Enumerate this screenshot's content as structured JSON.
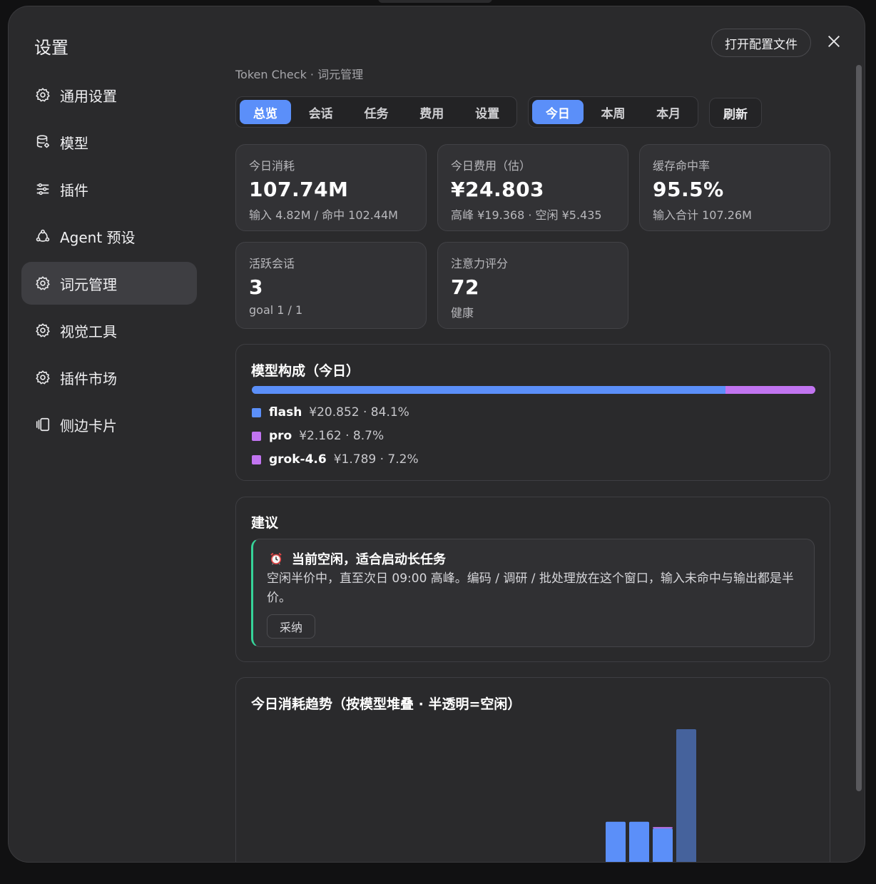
{
  "modal": {
    "title": "设置",
    "open_config_label": "打开配置文件",
    "close_icon": "close-icon"
  },
  "sidebar": {
    "items": [
      {
        "label": "通用设置",
        "icon": "gear-icon",
        "active": false
      },
      {
        "label": "模型",
        "icon": "database-icon",
        "active": false
      },
      {
        "label": "插件",
        "icon": "sliders-icon",
        "active": false
      },
      {
        "label": "Agent 预设",
        "icon": "agent-cycle-icon",
        "active": false
      },
      {
        "label": "词元管理",
        "icon": "gear-icon",
        "active": true
      },
      {
        "label": "视觉工具",
        "icon": "gear-icon",
        "active": false
      },
      {
        "label": "插件市场",
        "icon": "gear-icon",
        "active": false
      },
      {
        "label": "侧边卡片",
        "icon": "cards-icon",
        "active": false
      }
    ]
  },
  "breadcrumb": "Token Check · 词元管理",
  "tabs": [
    {
      "label": "总览",
      "active": true
    },
    {
      "label": "会话",
      "active": false
    },
    {
      "label": "任务",
      "active": false
    },
    {
      "label": "费用",
      "active": false
    },
    {
      "label": "设置",
      "active": false
    }
  ],
  "ranges": [
    {
      "label": "今日",
      "active": true
    },
    {
      "label": "本周",
      "active": false
    },
    {
      "label": "本月",
      "active": false
    }
  ],
  "refresh_label": "刷新",
  "stats": [
    {
      "label": "今日消耗",
      "value": "107.74M",
      "sub": "输入 4.82M / 命中 102.44M"
    },
    {
      "label": "今日费用（估）",
      "value": "¥24.803",
      "sub": "高峰 ¥19.368 · 空闲 ¥5.435"
    },
    {
      "label": "缓存命中率",
      "value": "95.5%",
      "sub": "输入合计 107.26M"
    },
    {
      "label": "活跃会话",
      "value": "3",
      "sub": "goal 1 / 1"
    },
    {
      "label": "注意力评分",
      "value": "72",
      "sub": "健康"
    }
  ],
  "composition": {
    "title": "模型构成（今日）",
    "models": [
      {
        "name": "flash",
        "detail": "¥20.852 · 84.1%",
        "share": 84.1,
        "color": "#5b8ff9"
      },
      {
        "name": "pro",
        "detail": "¥2.162 · 8.7%",
        "share": 8.7,
        "color": "#c174f0"
      },
      {
        "name": "grok-4.6",
        "detail": "¥1.789 · 7.2%",
        "share": 7.2,
        "color": "#c174f0"
      }
    ]
  },
  "suggestion": {
    "title": "建议",
    "icon": "alarm-clock-icon",
    "headline": "当前空闲，适合启动长任务",
    "body": "空闲半价中，直至次日 09:00 高峰。编码 / 调研 / 批处理放在这个窗口，输入未命中与输出都是半价。",
    "action_label": "采纳",
    "accent": "#36d399"
  },
  "trend": {
    "title": "今日消耗趋势（按模型堆叠 · 半透明=空闲）"
  },
  "chart_data": {
    "type": "bar",
    "title": "今日消耗趋势（按模型堆叠 · 半透明=空闲）",
    "stacked": true,
    "series": [
      {
        "name": "flash",
        "color": "#5b8ff9",
        "values": [
          31,
          31,
          26,
          100
        ]
      },
      {
        "name": "pro",
        "color": "#c174f0",
        "values": [
          0,
          0,
          1,
          0
        ]
      }
    ],
    "idle": [
      false,
      false,
      false,
      true
    ],
    "grid": false
  }
}
